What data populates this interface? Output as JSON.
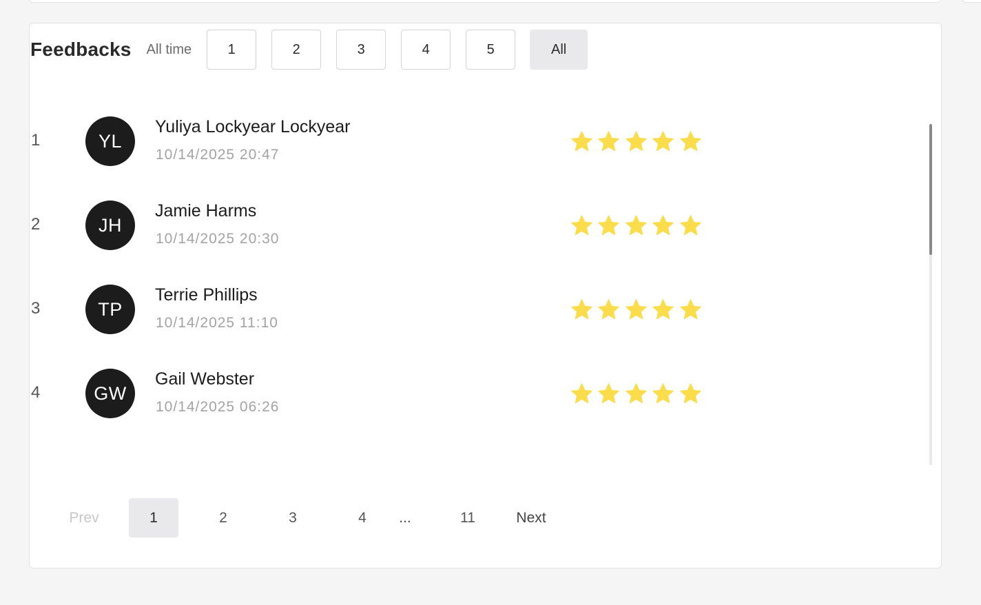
{
  "header": {
    "title": "Feedbacks",
    "period": "All time",
    "filters": [
      "1",
      "2",
      "3",
      "4",
      "5",
      "All"
    ],
    "active_filter": "All"
  },
  "feedbacks": [
    {
      "rank": "1",
      "initials": "YL",
      "name": "Yuliya Lockyear Lockyear",
      "date": "10/14/2025 20:47",
      "rating": 5
    },
    {
      "rank": "2",
      "initials": "JH",
      "name": "Jamie Harms",
      "date": "10/14/2025 20:30",
      "rating": 5
    },
    {
      "rank": "3",
      "initials": "TP",
      "name": "Terrie Phillips",
      "date": "10/14/2025 11:10",
      "rating": 5
    },
    {
      "rank": "4",
      "initials": "GW",
      "name": "Gail Webster",
      "date": "10/14/2025 06:26",
      "rating": 5
    }
  ],
  "pagination": {
    "prev": "Prev",
    "pages": [
      "1",
      "2",
      "3",
      "4"
    ],
    "ellipsis": "...",
    "last": "11",
    "next": "Next",
    "current": "1"
  },
  "colors": {
    "star": "#fbdc4b",
    "avatar_bg": "#1c1c1c",
    "active_bg": "#e9e9eb"
  },
  "icons": {
    "rating": "star-icon"
  }
}
